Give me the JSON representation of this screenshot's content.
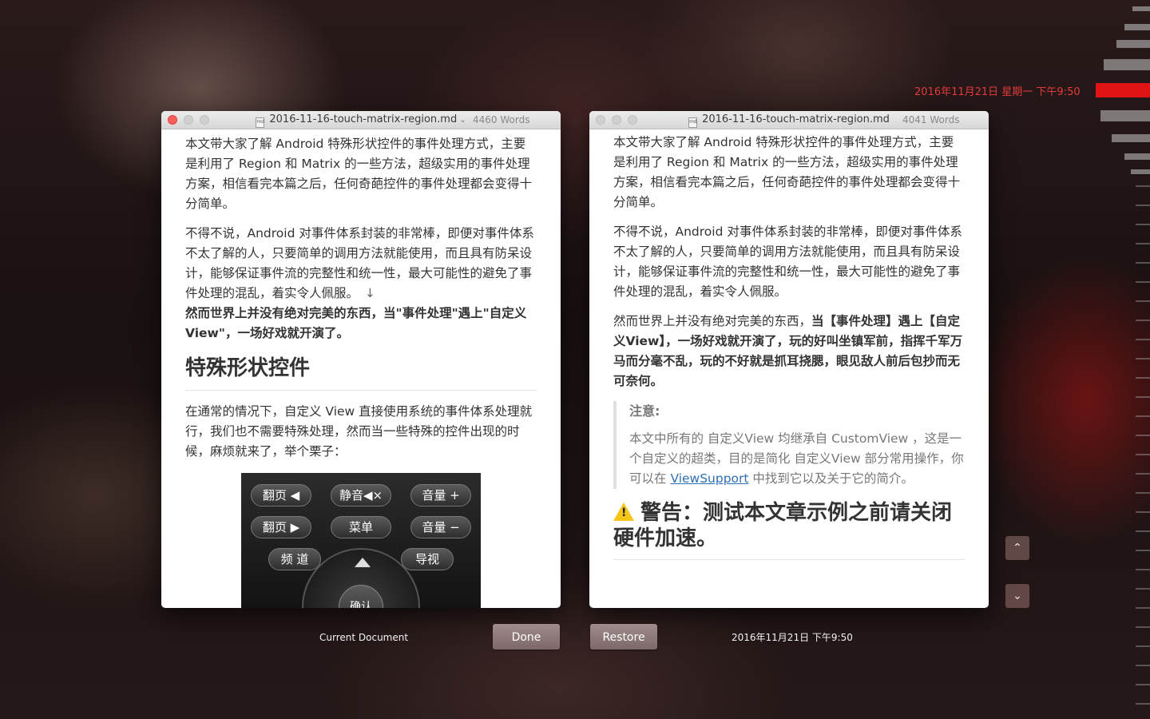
{
  "timeline": {
    "current_timestamp": "2016年11月21日 星期一 下午9:50"
  },
  "left_window": {
    "filename": "2016-11-16-touch-matrix-region.md",
    "word_count": "4460 Words",
    "paragraphs": {
      "p1": "本文带大家了解 Android 特殊形状控件的事件处理方式，主要是利用了 Region 和 Matrix 的一些方法，超级实用的事件处理方案，相信看完本篇之后，任何奇葩控件的事件处理都会变得十分简单。",
      "p2": "不得不说，Android 对事件体系封装的非常棒，即便对事件体系不太了解的人，只要简单的调用方法就能使用，而且具有防呆设计，能够保证事件流的完整性和统一性，最大可能性的避免了事件处理的混乱，着实令人佩服。",
      "p2_mark": "↓",
      "p3_bold": "然而世界上并没有绝对完美的东西，当\"事件处理\"遇上\"自定义View\"，一场好戏就开演了。",
      "h2": "特殊形状控件",
      "p4": "在通常的情况下，自定义 View 直接使用系统的事件体系处理就行，我们也不需要特殊处理，然而当一些特殊的控件出现的时候，麻烦就来了，举个栗子："
    },
    "remote_image": {
      "page_up_left": "翻页 ◀",
      "mute": "静音◀×",
      "volume_up": "音量 +",
      "page_up_right": "翻页 ▶",
      "menu": "菜单",
      "volume_down": "音量 −",
      "channel": "频 道",
      "guide": "导视",
      "ok": "确认"
    }
  },
  "right_window": {
    "filename": "2016-11-16-touch-matrix-region.md",
    "word_count": "4041 Words",
    "paragraphs": {
      "p1": "本文带大家了解 Android 特殊形状控件的事件处理方式，主要是利用了 Region 和 Matrix 的一些方法，超级实用的事件处理方案，相信看完本篇之后，任何奇葩控件的事件处理都会变得十分简单。",
      "p2": "不得不说，Android 对事件体系封装的非常棒，即便对事件体系不太了解的人，只要简单的调用方法就能使用，而且具有防呆设计，能够保证事件流的完整性和统一性，最大可能性的避免了事件处理的混乱，着实令人佩服。",
      "p3_normal": "然而世界上并没有绝对完美的东西，",
      "p3_bold": "当【事件处理】遇上【自定义View】，一场好戏就开演了，玩的好叫坐镇军前，指挥千军万马而分毫不乱，玩的不好就是抓耳挠腮，眼见敌人前后包抄而无可奈何。",
      "note_title": "注意:",
      "note_text_before": "本文中所有的 自定义View 均继承自 CustomView ，这是一个自定义的超类，目的是简化 自定义View 部分常用操作，你可以在 ",
      "note_link": "ViewSupport",
      "note_text_after": " 中找到它以及关于它的简介。",
      "warning_heading": "警告：测试本文章示例之前请关闭硬件加速。"
    }
  },
  "controls": {
    "current_document_label": "Current Document",
    "done_label": "Done",
    "restore_label": "Restore",
    "version_date": "2016年11月21日 下午9:50",
    "scroll_up_icon": "⌃",
    "scroll_down_icon": "⌄"
  },
  "colors": {
    "timeline_accent": "#e01414",
    "timestamp_text": "#e23b3b",
    "link": "#2e6fb3"
  }
}
